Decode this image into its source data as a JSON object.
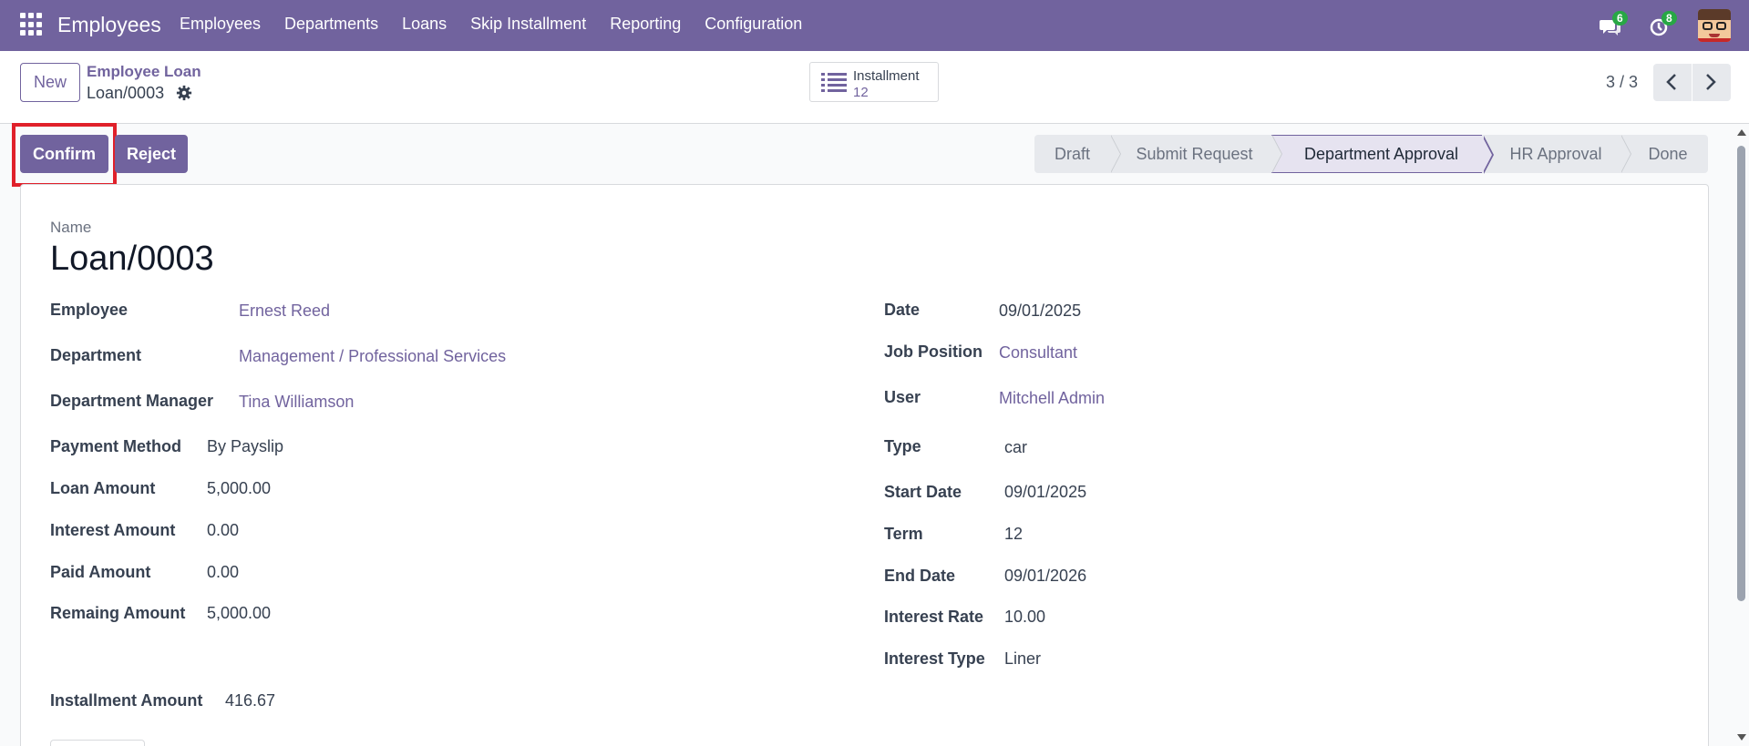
{
  "navbar": {
    "app_name": "Employees",
    "menu": [
      "Employees",
      "Departments",
      "Loans",
      "Skip Installment",
      "Reporting",
      "Configuration"
    ],
    "messages_count": "6",
    "activities_count": "8",
    "brand_color": "#71639e"
  },
  "control_panel": {
    "new_label": "New",
    "breadcrumb_parent": "Employee Loan",
    "breadcrumb_current": "Loan/0003",
    "smart_button": {
      "label": "Installment",
      "value": "12"
    },
    "pager_value": "3 / 3"
  },
  "statusbar": {
    "confirm_label": "Confirm",
    "reject_label": "Reject",
    "stages": [
      "Draft",
      "Submit Request",
      "Department Approval",
      "HR Approval",
      "Done"
    ],
    "active_stage": "Department Approval"
  },
  "form": {
    "name_label": "Name",
    "name_value": "Loan/0003",
    "left": [
      {
        "label": "Employee",
        "value": "Ernest Reed"
      },
      {
        "label": "Department",
        "value": "Management / Professional Services"
      },
      {
        "label": "Department Manager",
        "value": "Tina Williamson"
      },
      {
        "label": "Payment Method",
        "value": "By Payslip"
      },
      {
        "label": "Loan Amount",
        "value": "5,000.00"
      },
      {
        "label": "Interest Amount",
        "value": "0.00"
      },
      {
        "label": "Paid Amount",
        "value": "0.00"
      },
      {
        "label": "Remaing Amount",
        "value": "5,000.00"
      }
    ],
    "right": [
      {
        "label": "Date",
        "value": "09/01/2025"
      },
      {
        "label": "Job Position",
        "value": "Consultant"
      },
      {
        "label": "User",
        "value": "Mitchell Admin"
      },
      {
        "label": "Type",
        "value": "car"
      },
      {
        "label": "Start Date",
        "value": "09/01/2025"
      },
      {
        "label": "Term",
        "value": "12"
      },
      {
        "label": "End Date",
        "value": "09/01/2026"
      },
      {
        "label": "Interest Rate",
        "value": "10.00"
      },
      {
        "label": "Interest Type",
        "value": "Liner"
      }
    ],
    "installment_amount": {
      "label": "Installment Amount",
      "value": "416.67"
    }
  }
}
